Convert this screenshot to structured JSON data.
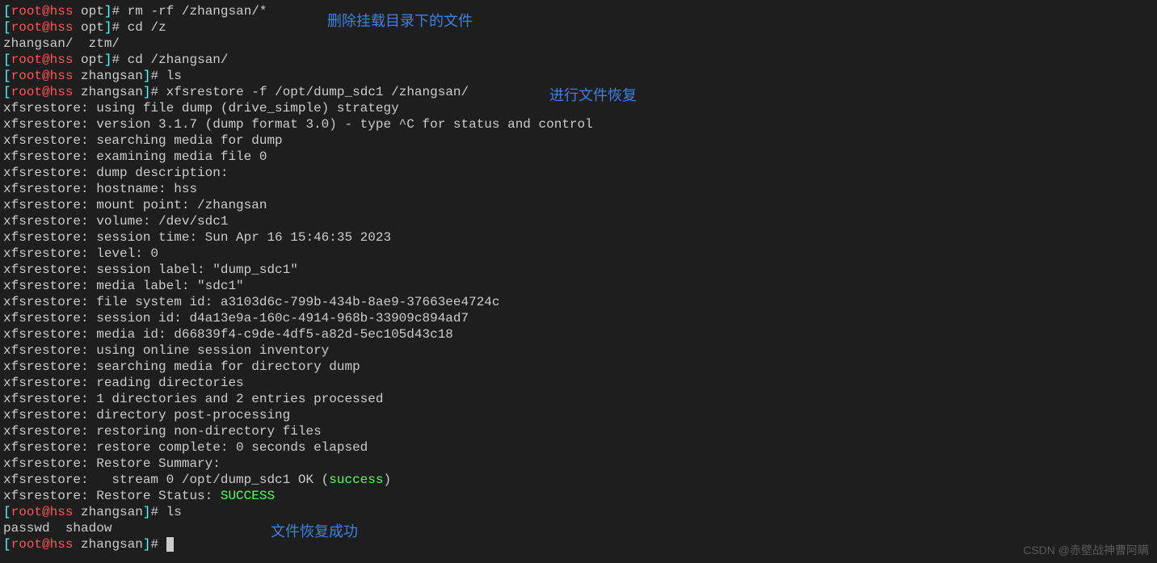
{
  "user": "root",
  "host": "hss",
  "paths": {
    "opt": "opt",
    "zhangsan": "zhangsan"
  },
  "commands": {
    "rm": "rm -rf /zhangsan/*",
    "cd_z": "cd /z",
    "tab_completion": "zhangsan/  ztm/",
    "cd_zhangsan": "cd /zhangsan/",
    "ls1": "ls",
    "xfsrestore": "xfsrestore -f /opt/dump_sdc1 /zhangsan/",
    "ls2": "ls",
    "ls_output": "passwd  shadow"
  },
  "output": {
    "l1": "xfsrestore: using file dump (drive_simple) strategy",
    "l2": "xfsrestore: version 3.1.7 (dump format 3.0) - type ^C for status and control",
    "l3": "xfsrestore: searching media for dump",
    "l4": "xfsrestore: examining media file 0",
    "l5": "xfsrestore: dump description:",
    "l6": "xfsrestore: hostname: hss",
    "l7": "xfsrestore: mount point: /zhangsan",
    "l8": "xfsrestore: volume: /dev/sdc1",
    "l9": "xfsrestore: session time: Sun Apr 16 15:46:35 2023",
    "l10": "xfsrestore: level: 0",
    "l11": "xfsrestore: session label: \"dump_sdc1\"",
    "l12": "xfsrestore: media label: \"sdc1\"",
    "l13": "xfsrestore: file system id: a3103d6c-799b-434b-8ae9-37663ee4724c",
    "l14": "xfsrestore: session id: d4a13e9a-160c-4914-968b-33909c894ad7",
    "l15": "xfsrestore: media id: d66839f4-c9de-4df5-a82d-5ec105d43c18",
    "l16": "xfsrestore: using online session inventory",
    "l17": "xfsrestore: searching media for directory dump",
    "l18": "xfsrestore: reading directories",
    "l19": "xfsrestore: 1 directories and 2 entries processed",
    "l20": "xfsrestore: directory post-processing",
    "l21": "xfsrestore: restoring non-directory files",
    "l22": "xfsrestore: restore complete: 0 seconds elapsed",
    "l23": "xfsrestore: Restore Summary:",
    "l24a": "xfsrestore:   stream 0 /opt/dump_sdc1 OK (",
    "l24b": "success",
    "l24c": ")",
    "l25a": "xfsrestore: Restore Status: ",
    "l25b": "SUCCESS"
  },
  "annotations": {
    "a1": "删除挂载目录下的文件",
    "a2": "进行文件恢复",
    "a3": "文件恢复成功"
  },
  "watermark": "CSDN @赤壁战神曹阿瞒"
}
